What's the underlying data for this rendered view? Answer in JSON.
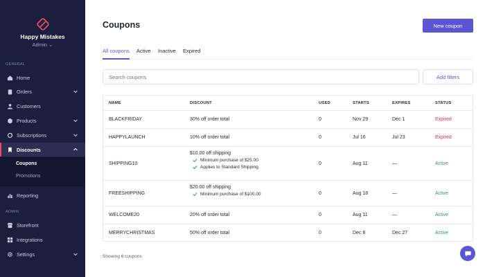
{
  "sidebar": {
    "brand_name": "Happy Mistakes",
    "role": "Admin ⌄",
    "general_label": "GENERAL",
    "admin_label": "ADMIN",
    "items": [
      {
        "label": "Home",
        "icon": "home-icon"
      },
      {
        "label": "Orders",
        "icon": "clipboard-icon",
        "expandable": true
      },
      {
        "label": "Customers",
        "icon": "users-icon"
      },
      {
        "label": "Products",
        "icon": "box-icon",
        "expandable": true
      },
      {
        "label": "Subscriptions",
        "icon": "refresh-icon",
        "expandable": true
      },
      {
        "label": "Discounts",
        "icon": "bookmark-icon",
        "expandable": true,
        "active": true
      }
    ],
    "subitems": [
      {
        "label": "Coupons",
        "active": true
      },
      {
        "label": "Promotions"
      }
    ],
    "items_after": [
      {
        "label": "Reporting",
        "icon": "chart-icon"
      }
    ],
    "admin_items": [
      {
        "label": "Storefront",
        "icon": "store-icon"
      },
      {
        "label": "Integrations",
        "icon": "grid-icon"
      },
      {
        "label": "Settings",
        "icon": "gear-icon",
        "expandable": true
      }
    ]
  },
  "header": {
    "title": "Coupons",
    "new_button": "New coupon"
  },
  "tabs": [
    "All coupons",
    "Active",
    "Inactive",
    "Expired"
  ],
  "search": {
    "placeholder": "Search coupons"
  },
  "filters_button": "Add filters",
  "table": {
    "columns": [
      "NAME",
      "DISCOUNT",
      "USED",
      "STARTS",
      "EXPIRES",
      "STATUS"
    ],
    "rows": [
      {
        "name": "BLACKFRIDAY",
        "discount": "30% off order total",
        "details": [],
        "used": "0",
        "starts": "Nov 29",
        "expires": "Dec 1",
        "status": "Expired"
      },
      {
        "name": "HAPPYLAUNCH",
        "discount": "10% off order total",
        "details": [],
        "used": "0",
        "starts": "Jul 16",
        "expires": "Jul 23",
        "status": "Expired"
      },
      {
        "name": "SHIPPING10",
        "discount": "$10.00 off shipping",
        "details": [
          "Minimum purchase of $25.00",
          "Applies to Standard Shipping"
        ],
        "used": "0",
        "starts": "Aug 11",
        "expires": "—",
        "status": "Active"
      },
      {
        "name": "FREESHIPPING",
        "discount": "$20.00 off shipping",
        "details": [
          "Minimum purchase of $100.00"
        ],
        "used": "0",
        "starts": "Aug 18",
        "expires": "—",
        "status": "Active"
      },
      {
        "name": "WELCOME20",
        "discount": "20% off order total",
        "details": [],
        "used": "0",
        "starts": "Aug 11",
        "expires": "—",
        "status": "Active"
      },
      {
        "name": "MERRYCHRISTMAS",
        "discount": "50% off order total",
        "details": [],
        "used": "0",
        "starts": "Dec 8",
        "expires": "Dec 27",
        "status": "Active"
      }
    ]
  },
  "footer": "Showing 6 coupons",
  "colors": {
    "accent": "#5b55d6",
    "sidebar": "#1b1e3c",
    "expired": "#d0344d",
    "active": "#2c9b5d",
    "brand": "#e24c6a"
  }
}
